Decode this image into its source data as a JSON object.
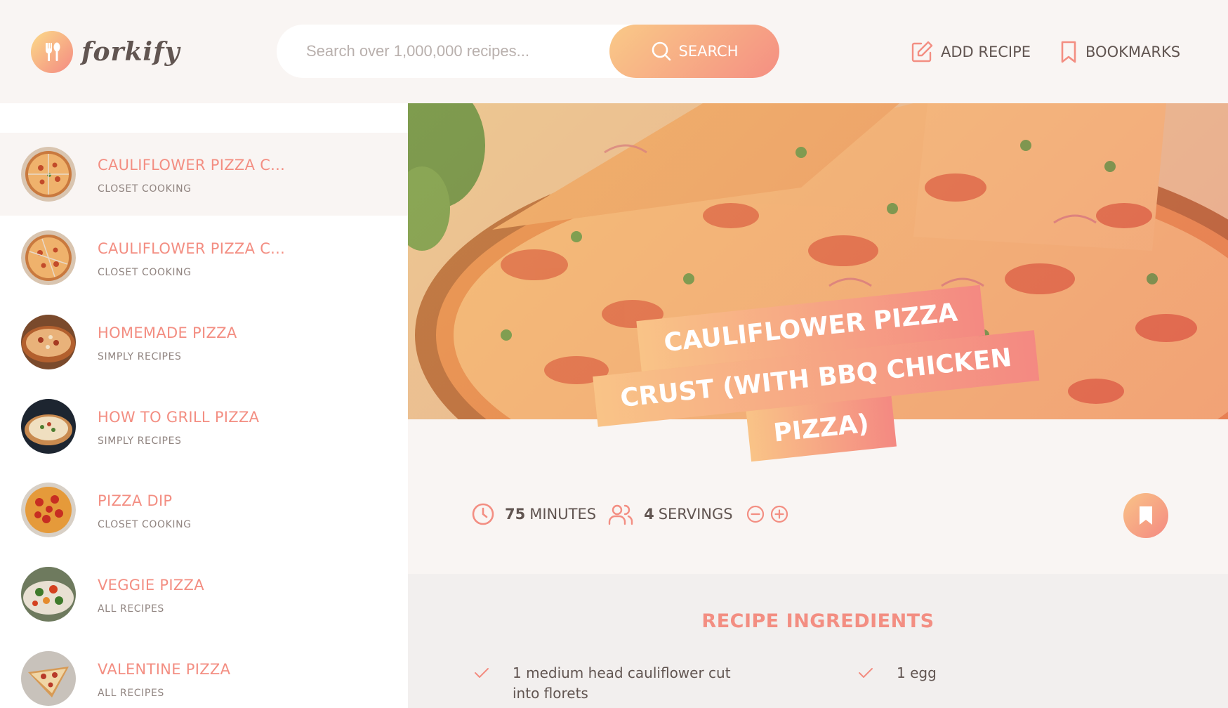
{
  "header": {
    "logo_text": "forkify",
    "search": {
      "placeholder": "Search over 1,000,000 recipes...",
      "value": "",
      "button_label": "SEARCH"
    },
    "nav": {
      "add_recipe": "ADD RECIPE",
      "bookmarks": "BOOKMARKS"
    }
  },
  "results": [
    {
      "title": "CAULIFLOWER PIZZA C...",
      "publisher": "CLOSET COOKING"
    },
    {
      "title": "CAULIFLOWER PIZZA C...",
      "publisher": "CLOSET COOKING"
    },
    {
      "title": "HOMEMADE PIZZA",
      "publisher": "SIMPLY RECIPES"
    },
    {
      "title": "HOW TO GRILL PIZZA",
      "publisher": "SIMPLY RECIPES"
    },
    {
      "title": "PIZZA DIP",
      "publisher": "CLOSET COOKING"
    },
    {
      "title": "VEGGIE PIZZA",
      "publisher": "ALL RECIPES"
    },
    {
      "title": "VALENTINE PIZZA",
      "publisher": "ALL RECIPES"
    }
  ],
  "recipe": {
    "title_lines": [
      "CAULIFLOWER PIZZA",
      "CRUST (WITH BBQ CHICKEN",
      "PIZZA)"
    ],
    "minutes": "75",
    "minutes_label": "MINUTES",
    "servings": "4",
    "servings_label": "SERVINGS",
    "ingredients_heading": "RECIPE INGREDIENTS",
    "ingredients": [
      "1 medium head cauliflower cut into florets",
      "1 egg"
    ]
  },
  "colors": {
    "accent_light": "#fbdb89",
    "accent_dark": "#f48982",
    "text": "#615551"
  }
}
